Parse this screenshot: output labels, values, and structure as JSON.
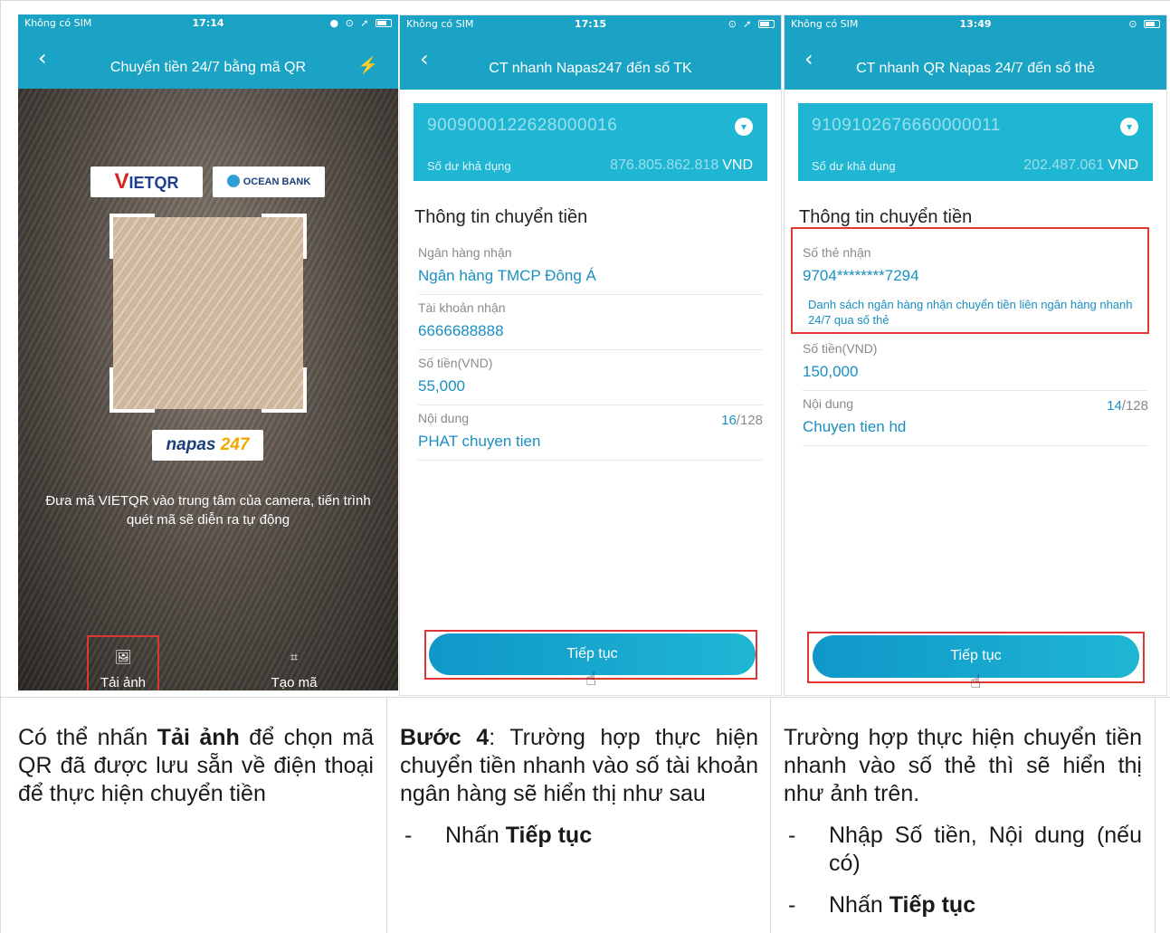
{
  "screen1": {
    "status": {
      "carrier": "Không có SIM",
      "time": "17:14",
      "indicators": "● ⊙ ➚"
    },
    "nav": {
      "back": "‹",
      "title": "Chuyển tiền 24/7 bằng mã QR",
      "flash": "⚡"
    },
    "logos": {
      "vietqr_v": "V",
      "vietqr_rest": "IETQR",
      "oceanbank": "OCEAN BANK",
      "napas": "napas",
      "napas_num": "247"
    },
    "instruction": "Đưa mã VIETQR vào trung tâm của camera, tiến trình quét mã sẽ diễn ra tự động",
    "actions": {
      "upload_icon": "🖼",
      "upload": "Tải ảnh",
      "create_icon": "⌗",
      "create": "Tạo mã"
    }
  },
  "screen2": {
    "status": {
      "carrier": "Không có SIM",
      "time": "17:15",
      "indicators": "⊙ ➚"
    },
    "nav": {
      "back": "‹",
      "title": "CT nhanh Napas247 đến số TK"
    },
    "account": {
      "number": "9009000122628000016",
      "balance_label": "Số dư khả dụng",
      "balance_masked": "876.805.862.818",
      "currency": "VND"
    },
    "section_title": "Thông tin chuyển tiền",
    "fields": [
      {
        "label": "Ngân hàng nhận",
        "value": "Ngân hàng TMCP Đông Á"
      },
      {
        "label": "Tài khoản nhận",
        "value": "6666688888"
      },
      {
        "label": "Số tiền(VND)",
        "value": "55,000"
      },
      {
        "label": "Nội dung",
        "value": "PHAT chuyen tien",
        "count_used": "16",
        "count_max": "/128"
      }
    ],
    "button": "Tiếp tục"
  },
  "screen3": {
    "status": {
      "carrier": "Không có SIM",
      "time": "13:49",
      "indicators": "⊙"
    },
    "nav": {
      "back": "‹",
      "title": "CT nhanh QR Napas 24/7 đến số thẻ"
    },
    "account": {
      "number": "9109102676660000011",
      "balance_label": "Số dư khả dụng",
      "balance_masked": "202.487.061",
      "currency": "VND"
    },
    "section_title": "Thông tin chuyển tiền",
    "card_field": {
      "label": "Số thẻ nhận",
      "value": "9704********7294"
    },
    "hint": "Danh sách ngân hàng nhận chuyển tiền liên ngân hàng nhanh 24/7 qua số thẻ",
    "fields": [
      {
        "label": "Số tiền(VND)",
        "value": "150,000"
      },
      {
        "label": "Nội dung",
        "value": "Chuyen tien hd",
        "count_used": "14",
        "count_max": "/128"
      }
    ],
    "button": "Tiếp tục"
  },
  "captions": {
    "col1": {
      "pre": "Có thể nhấn ",
      "bold": "Tải ảnh",
      "post": " để chọn mã QR đã được lưu sẵn về điện thoại để thực hiện chuyển tiền"
    },
    "col2": {
      "bold": "Bước 4",
      "post": ": Trường hợp thực hiện chuyển tiền nhanh vào số tài khoản ngân hàng sẽ hiển thị như sau",
      "bullet_pre": "Nhấn ",
      "bullet_bold": "Tiếp tục"
    },
    "col3": {
      "text": "Trường hợp thực hiện chuyển tiền nhanh vào số thẻ thì sẽ hiển thị như ảnh trên.",
      "bullet1": "Nhập Số tiền, Nội dung (nếu có)",
      "bullet2_pre": "Nhấn ",
      "bullet2_bold": "Tiếp tục"
    },
    "dash": "-"
  }
}
